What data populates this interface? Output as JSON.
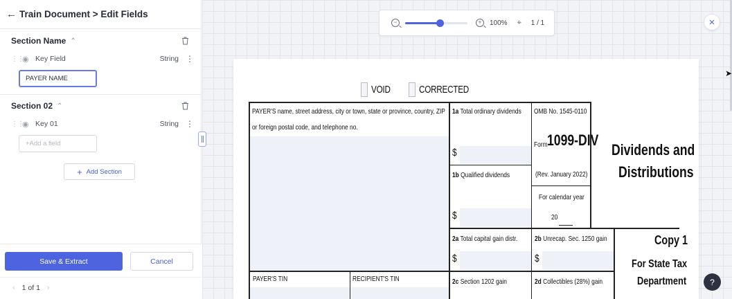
{
  "header": {
    "title": "Train Document > Edit Fields",
    "back_icon": "arrow-left-icon"
  },
  "sections": [
    {
      "name": "Section Name",
      "field": {
        "name": "Key Field",
        "type": "String"
      },
      "input_value": "PAYER NAME"
    },
    {
      "name": "Section 02",
      "field": {
        "name": "Key 01",
        "type": "String"
      },
      "input_placeholder": "+Add a field"
    }
  ],
  "add_section_label": "Add Section",
  "footer": {
    "save_label": "Save & Extract",
    "cancel_label": "Cancel",
    "pager": "1 of 1"
  },
  "viewer": {
    "zoom": "100%",
    "zoom_level_fraction": 0.55,
    "page_indicator": "1 / 1",
    "help_label": "?"
  },
  "colors": {
    "accent": "#4d63e0",
    "help_bg": "#2d3240"
  },
  "document": {
    "void_label": "VOID",
    "corrected_label": "CORRECTED",
    "payer_box_label_1": "PAYER'S name, street address, city or town, state or province, country, ZIP",
    "payer_box_label_2": "or foreign postal code, and telephone no.",
    "box_1a_num": "1a",
    "box_1a_label": "Total ordinary dividends",
    "box_1b_num": "1b",
    "box_1b_label": "Qualified dividends",
    "omb": "OMB No. 1545-0110",
    "form_prefix": "Form",
    "form_name": "1099-DIV",
    "rev": "(Rev. January 2022)",
    "cal_year_label": "For calendar year",
    "cal_year_value": "20",
    "title_line1": "Dividends and",
    "title_line2": "Distributions",
    "box_2a_num": "2a",
    "box_2a_label": "Total capital gain distr.",
    "box_2b_num": "2b",
    "box_2b_label": "Unrecap. Sec. 1250 gain",
    "box_2c_num": "2c",
    "box_2c_label": "Section 1202 gain",
    "box_2d_num": "2d",
    "box_2d_label": "Collectibles (28%) gain",
    "copy_title": "Copy 1",
    "copy_sub1": "For State Tax",
    "copy_sub2": "Department",
    "payer_tin": "PAYER'S TIN",
    "recipient_tin": "RECIPIENT'S TIN",
    "dollar_sign": "$"
  }
}
